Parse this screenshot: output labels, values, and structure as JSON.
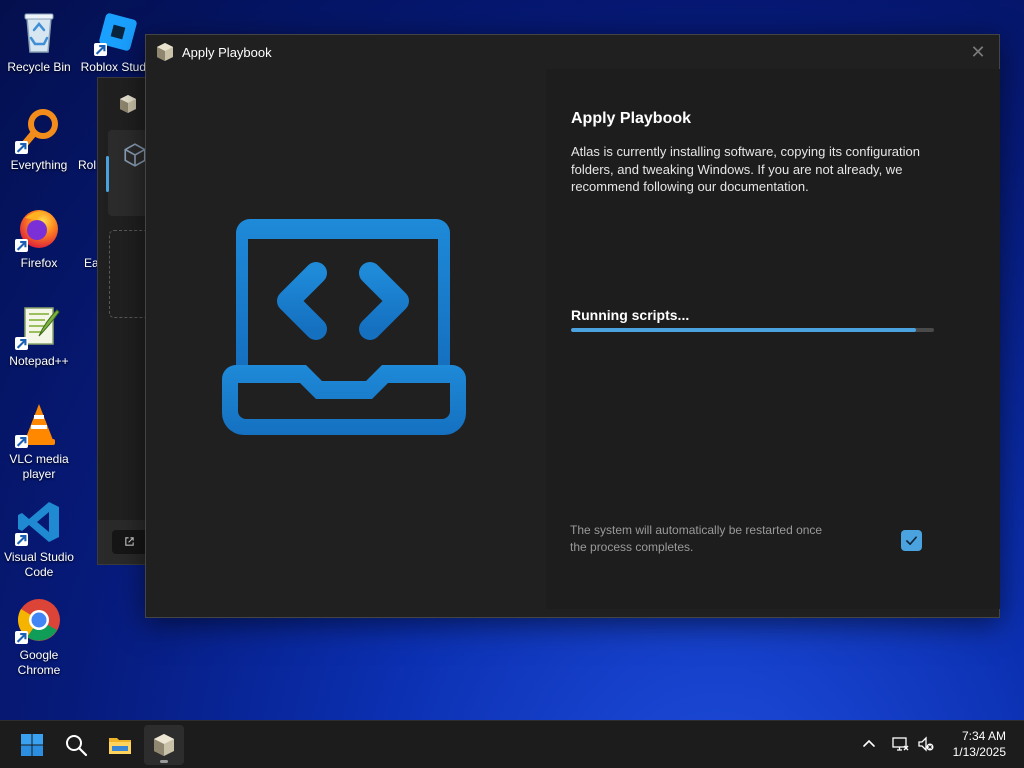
{
  "desktop": {
    "icons": [
      {
        "label": "Recycle Bin",
        "icon": "recycle-bin-icon"
      },
      {
        "label": "Roblox Studio",
        "icon": "roblox-studio-icon"
      },
      {
        "label": "Everything",
        "icon": "everything-search-icon"
      },
      {
        "label": "Firefox",
        "icon": "firefox-icon"
      },
      {
        "label": "Notepad++",
        "icon": "notepadpp-icon"
      },
      {
        "label": "VLC media player",
        "icon": "vlc-icon"
      },
      {
        "label": "Visual Studio Code",
        "icon": "vscode-icon"
      },
      {
        "label": "Google Chrome",
        "icon": "chrome-icon"
      }
    ],
    "partial_labels": {
      "roblox_second": "Rol",
      "third_col": "Ea"
    }
  },
  "dialog": {
    "title": "Apply Playbook",
    "heading": "Apply Playbook",
    "description": "Atlas is currently installing software, copying its configuration folders, and tweaking Windows. If you are not already, we recommend following our documentation.",
    "progress_label": "Running scripts...",
    "progress_fraction": 0.95,
    "restart_note": "The system will automatically be restarted once the process completes.",
    "restart_checked": true,
    "close_glyph": "✕"
  },
  "taskbar": {
    "buttons": [
      "start-icon",
      "search-icon",
      "file-explorer-icon",
      "atlas-toolbox-icon"
    ],
    "tray": [
      "chevron-up-icon",
      "network-icon",
      "volume-muted-icon"
    ],
    "time": "7:34 AM",
    "date": "1/13/2025"
  },
  "colors": {
    "accent": "#4aa3df",
    "dialog_bg": "#202020",
    "hero_blue": "#1a7fd0"
  }
}
